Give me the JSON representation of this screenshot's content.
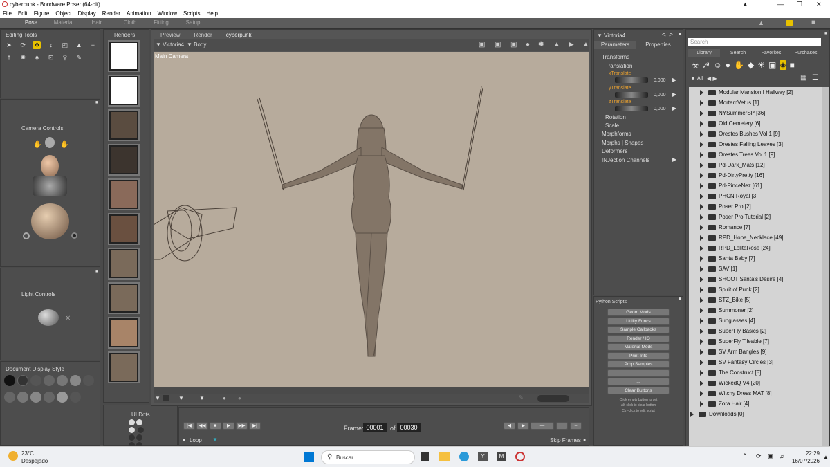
{
  "titlebar": {
    "title": "cyberpunk - Bondware Poser (64-bit)"
  },
  "menu": [
    "File",
    "Edit",
    "Figure",
    "Object",
    "Display",
    "Render",
    "Animation",
    "Window",
    "Scripts",
    "Help"
  ],
  "rooms": [
    "Pose",
    "Material",
    "Hair",
    "Cloth",
    "Fitting",
    "Setup"
  ],
  "editing_tools": {
    "title": "Editing Tools"
  },
  "camera_controls": {
    "title": "Camera Controls"
  },
  "light_controls": {
    "title": "Light Controls"
  },
  "document_display": {
    "title": "Document Display Style"
  },
  "renders": {
    "title": "Renders"
  },
  "ui_dots": {
    "title": "UI Dots"
  },
  "doc_tabs": {
    "preview": "Preview",
    "render": "Render",
    "doc": "cyberpunk"
  },
  "viewport": {
    "figure": "Victoria4",
    "part": "Body",
    "camera": "Main Camera"
  },
  "frame": {
    "label": "Frame:",
    "current": "00001",
    "of": "of",
    "total": "00030",
    "loop": "Loop",
    "skip": "Skip Frames"
  },
  "params": {
    "figure": "Victoria4",
    "tab_params": "Parameters",
    "tab_props": "Properties",
    "transforms": "Transforms",
    "translation": "Translation",
    "x_label": "xTranslate",
    "x_val": "0,000",
    "y_label": "yTranslate",
    "y_val": "0,000",
    "z_label": "zTranslate",
    "z_val": "0,000",
    "rotation": "Rotation",
    "scale": "Scale",
    "morphforms": "Morphforms",
    "morphs": "Morphs | Shapes",
    "deformers": "Deformers",
    "injection": "INJection Channels"
  },
  "python": {
    "title": "Python Scripts",
    "buttons": [
      "Geom Mods",
      "Utility Funcs",
      "Sample Callbacks",
      "Render / IO",
      "Material Mods",
      "Print Info",
      "Prop Samples",
      "",
      "...",
      "Clear Buttons"
    ],
    "hint1": "Click empty button to set",
    "hint2": "Alt-click to clear button",
    "hint3": "Ctrl-click to edit script"
  },
  "library": {
    "search_placeholder": "Search",
    "tabs": [
      "Library",
      "Search",
      "Favorites",
      "Purchases"
    ],
    "filter": "All",
    "items": [
      "Modular Mansion I Hallway [2]",
      "MortemVetus [1]",
      "NYSummerSP [36]",
      "Old Cemetery [6]",
      "Orestes Bushes Vol 1 [9]",
      "Orestes Falling Leaves [3]",
      "Orestes Trees Vol 1 [9]",
      "Pd-Dark_Mats [12]",
      "Pd-DirtyPretty [16]",
      "Pd-PinceNez [61]",
      "PHCN Royal [3]",
      "Poser Pro [2]",
      "Poser Pro Tutorial [2]",
      "Romance [7]",
      "RPD_Hope_Necklace [49]",
      "RPD_LolitaRose [24]",
      "Santa Baby [7]",
      "SAV [1]",
      "SHOOT Santa's Desire [4]",
      "Spirit of Punk [2]",
      "STZ_Bike [5]",
      "Summoner [2]",
      "Sunglasses [4]",
      "SuperFly Basics [2]",
      "SuperFly Tileable [7]",
      "SV Arm Bangles [9]",
      "SV Fantasy Circles [3]",
      "The Construct [5]",
      "WickedQ V4 [20]",
      "Witchy Dress MAT [8]",
      "Zora Hair [4]"
    ],
    "downloads": "Downloads [0]",
    "more": "..."
  },
  "taskbar": {
    "temp": "23°C",
    "weather": "Despejado",
    "search": "Buscar",
    "time": "22:29",
    "date": "16/07/2026"
  }
}
